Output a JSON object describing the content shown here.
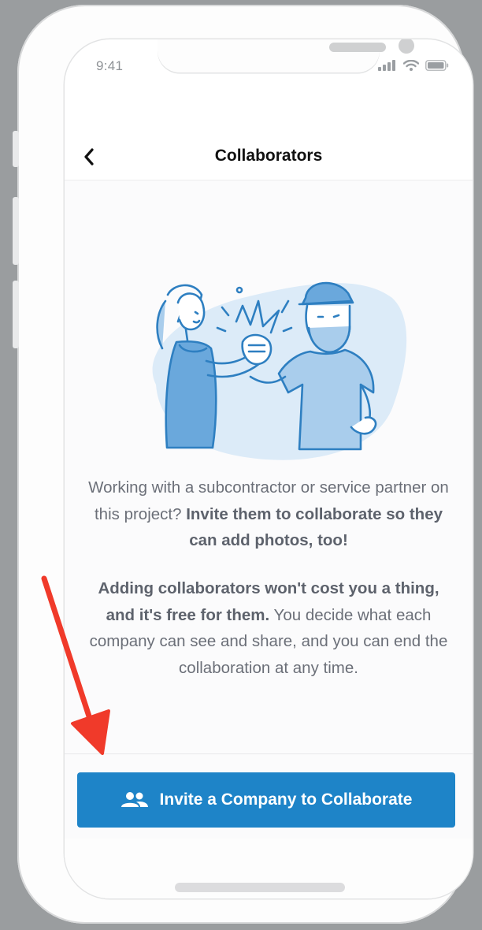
{
  "status_bar": {
    "time": "9:41"
  },
  "nav": {
    "title": "Collaborators",
    "back_icon": "chevron-left-icon"
  },
  "illustration": {
    "icon": "high-five-illustration",
    "accent": "#2e7fc1",
    "blob": "#dcebf8"
  },
  "body": {
    "p1_normal": "Working with a subcontractor or service partner on this project? ",
    "p1_bold": "Invite them to collaborate so they can add photos, too!",
    "p2_bold": "Adding collaborators won't cost you a thing, and it's free for them.",
    "p2_normal": " You decide what each company can see and share, and you can end the collaboration at any time."
  },
  "cta": {
    "label": "Invite a Company to Collaborate",
    "icon": "people-icon",
    "color": "#1e84c8"
  },
  "annotation": {
    "icon": "red-arrow",
    "color": "#f03a2a"
  }
}
